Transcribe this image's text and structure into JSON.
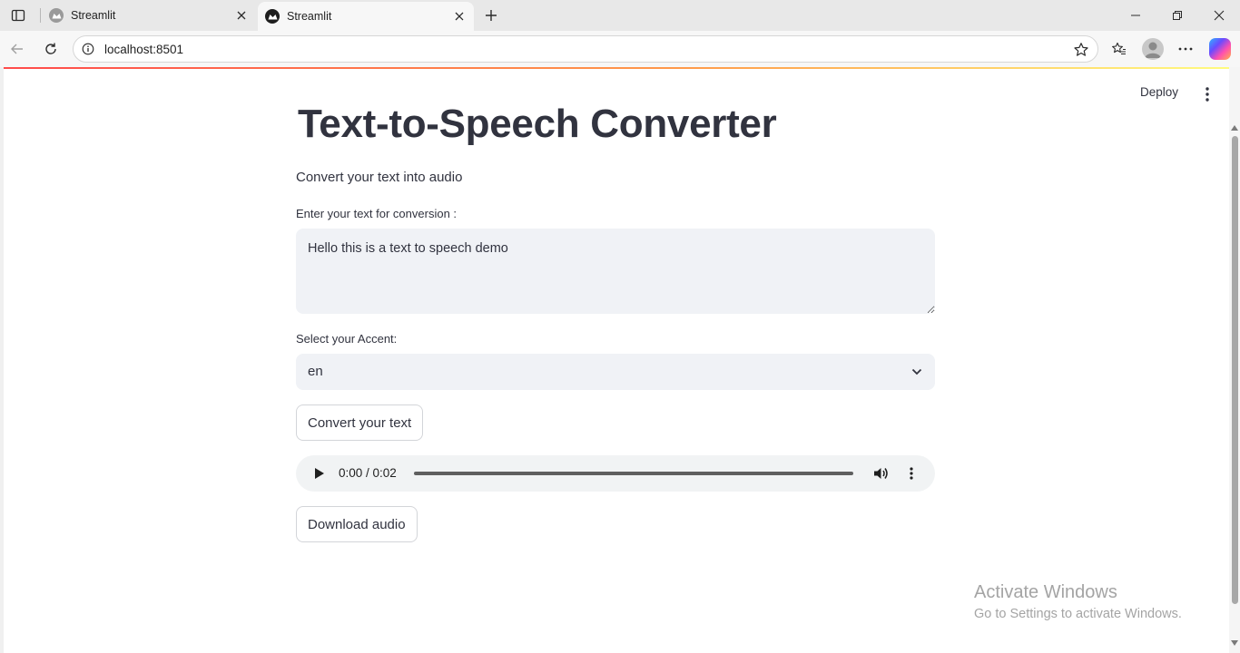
{
  "browser": {
    "tabs": [
      {
        "title": "Streamlit",
        "active": false
      },
      {
        "title": "Streamlit",
        "active": true
      }
    ],
    "url": "localhost:8501"
  },
  "app": {
    "deploy_label": "Deploy",
    "title": "Text-to-Speech Converter",
    "subtitle": "Convert your text into audio",
    "text_input": {
      "label": "Enter your text for conversion :",
      "value": "Hello this is a text to speech demo"
    },
    "accent_select": {
      "label": "Select your Accent:",
      "value": "en"
    },
    "convert_button": "Convert your text",
    "audio_player": {
      "time": "0:00 / 0:02",
      "progress": 0
    },
    "download_button": "Download audio"
  },
  "watermark": {
    "line1": "Activate Windows",
    "line2": "Go to Settings to activate Windows."
  },
  "colors": {
    "text": "#31333f",
    "input_bg": "#f0f2f6",
    "accent_gradient_start": "#ff4b4b",
    "accent_gradient_end": "#fffd80"
  }
}
